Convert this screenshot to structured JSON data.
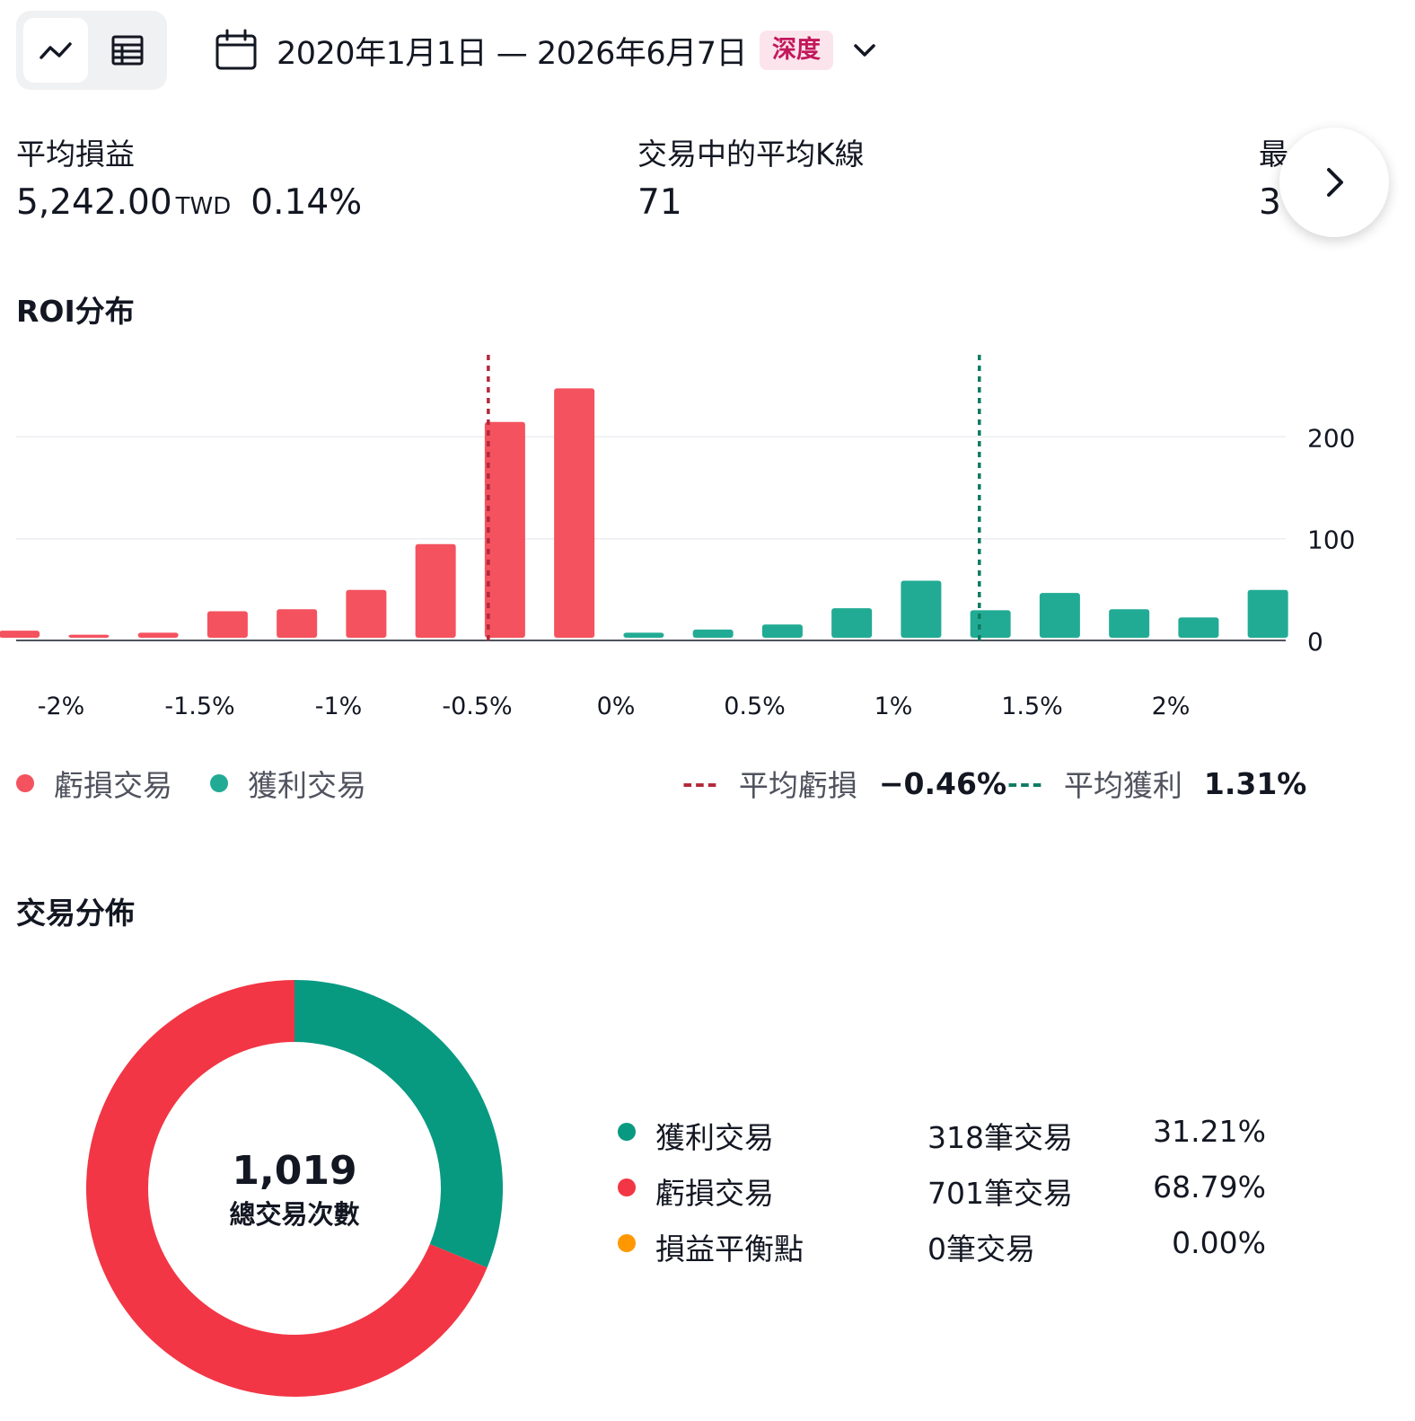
{
  "toolbar": {
    "date_range": "2020年1月1日 — 2026年6月7日",
    "depth_badge": "深度"
  },
  "metrics": [
    {
      "label": "平均損益",
      "value": "5,242.00",
      "unit": "TWD",
      "percent": "0.14%"
    },
    {
      "label": "交易中的平均K線",
      "value": "71"
    },
    {
      "label": "最",
      "value": "3"
    }
  ],
  "roi_section": {
    "title": "ROI分布",
    "legend": {
      "loss_label": "虧損交易",
      "profit_label": "獲利交易",
      "avg_loss_label": "平均虧損",
      "avg_loss_value": "−0.46%",
      "avg_profit_label": "平均獲利",
      "avg_profit_value": "1.31%"
    }
  },
  "chart_data": {
    "type": "bar",
    "title": "ROI分布",
    "x_tick_labels": [
      "-2%",
      "-1.5%",
      "-1%",
      "-0.5%",
      "0%",
      "0.5%",
      "1%",
      "1.5%",
      "2%"
    ],
    "y_tick_labels": [
      "0",
      "100",
      "200"
    ],
    "ylim": [
      0,
      280
    ],
    "y_axis_position": "right",
    "grid": true,
    "bin_width": 0.25,
    "series": [
      {
        "name": "虧損交易",
        "color": "#f4525f",
        "x": [
          -2.15,
          -1.9,
          -1.65,
          -1.4,
          -1.15,
          -0.9,
          -0.65,
          -0.4,
          -0.15
        ],
        "values": [
          7,
          3,
          5,
          26,
          28,
          47,
          92,
          212,
          245
        ]
      },
      {
        "name": "獲利交易",
        "color": "#22ab94",
        "x": [
          0.1,
          0.35,
          0.6,
          0.85,
          1.1,
          1.35,
          1.6,
          1.85,
          2.1,
          2.35
        ],
        "values": [
          5,
          8,
          13,
          29,
          56,
          27,
          44,
          28,
          20,
          47
        ]
      }
    ],
    "reference_lines": [
      {
        "name": "平均虧損",
        "x": -0.46,
        "color": "#b2283a",
        "style": "dotted"
      },
      {
        "name": "平均獲利",
        "x": 1.31,
        "color": "#0f7a63",
        "style": "dotted"
      }
    ]
  },
  "distribution": {
    "title": "交易分佈",
    "total": "1,019",
    "total_label": "總交易次數",
    "items": [
      {
        "label": "獲利交易",
        "count": "318筆交易",
        "percent": "31.21%",
        "color": "#089981",
        "value": 318
      },
      {
        "label": "虧損交易",
        "count": "701筆交易",
        "percent": "68.79%",
        "color": "#f23645",
        "value": 701
      },
      {
        "label": "損益平衡點",
        "count": "0筆交易",
        "percent": "0.00%",
        "color": "#ff9800",
        "value": 0
      }
    ]
  },
  "icons": {
    "chart_view": "line-chart-icon",
    "table_view": "table-icon",
    "calendar": "calendar-icon",
    "dropdown": "chevron-down-icon",
    "next": "chevron-right-icon"
  }
}
